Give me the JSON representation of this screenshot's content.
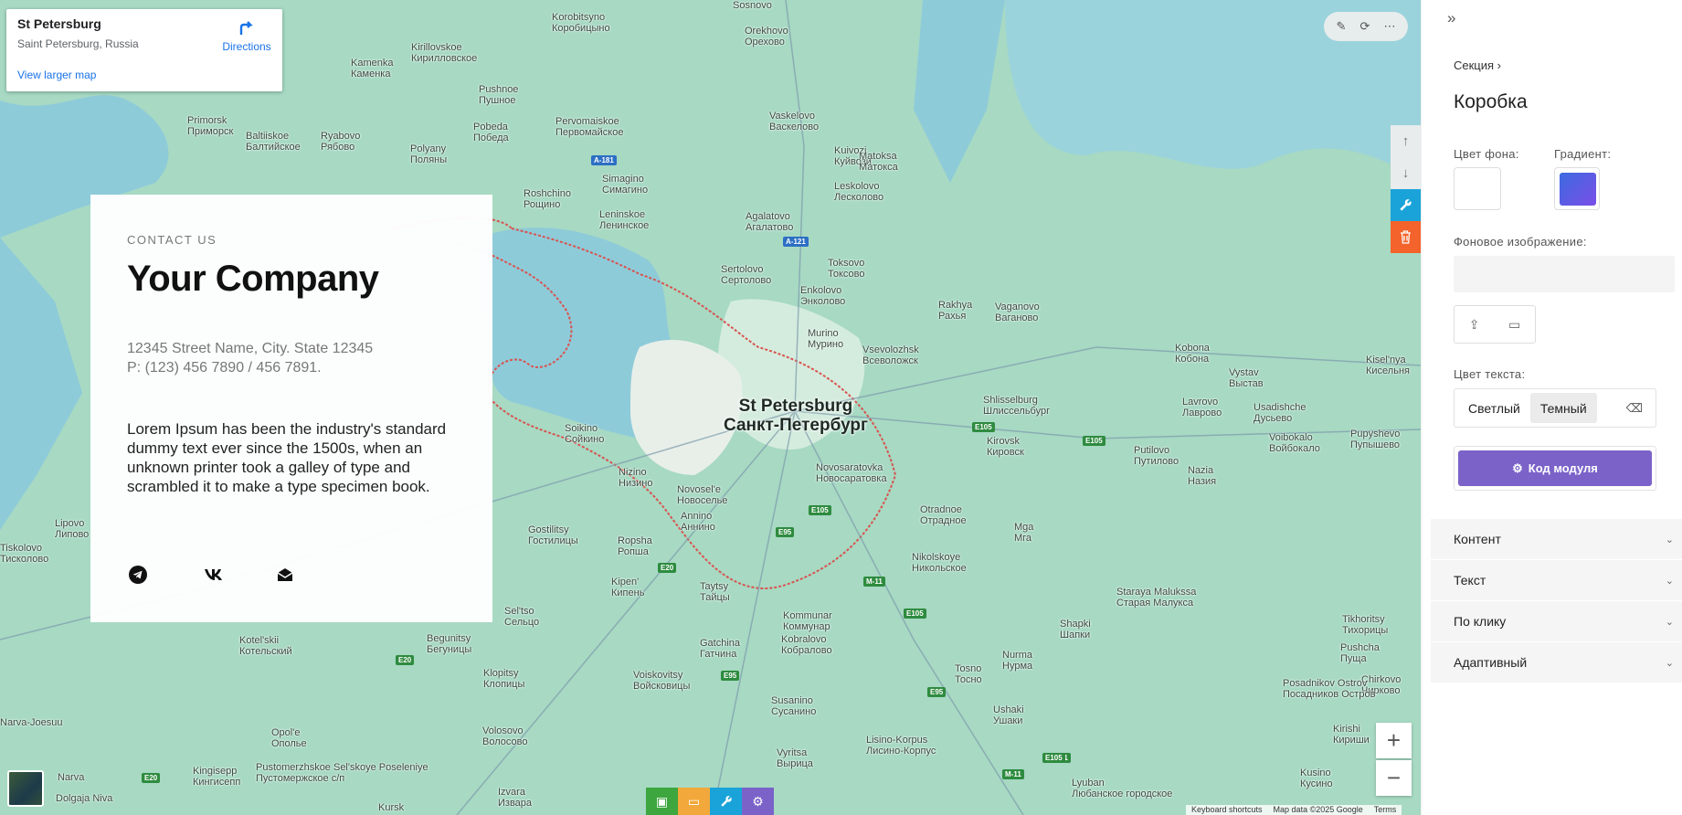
{
  "map": {
    "infocard": {
      "name": "St Petersburg",
      "address": "Saint Petersburg, Russia",
      "directions": "Directions",
      "larger_map": "View larger map"
    },
    "city_main": [
      "St Petersburg",
      "Санкт-Петербург"
    ],
    "places": [
      [
        "Korobitsyno",
        "Коробицыно"
      ],
      [
        "Orekhovo",
        "Орехово"
      ],
      [
        "Sosnovo",
        "Сосново"
      ],
      [
        "Kirillovskoe",
        "Кирилловское"
      ],
      [
        "Kamenka",
        "Каменка"
      ],
      [
        "Pushnoe",
        "Пушное"
      ],
      [
        "Pervomaiskoe",
        "Первомайское"
      ],
      [
        "Vaskelovo",
        "Васкелово"
      ],
      [
        "Primorsk",
        "Приморск"
      ],
      [
        "Baltiiskoe",
        "Балтийское"
      ],
      [
        "Ryabovo",
        "Рябово"
      ],
      [
        "Pobeda",
        "Победа"
      ],
      [
        "Polyany",
        "Поляны"
      ],
      [
        "Kuivozi",
        "Куйвози"
      ],
      [
        "Matoksa",
        "Матокса"
      ],
      [
        "Simagino",
        "Симагино"
      ],
      [
        "Leskolovo",
        "Лесколово"
      ],
      [
        "Roshchino",
        "Рощино"
      ],
      [
        "Leninskoe",
        "Ленинское"
      ],
      [
        "Agalatovo",
        "Агалатово"
      ],
      [
        "Sertolovo",
        "Сертолово"
      ],
      [
        "Toksovo",
        "Токсово"
      ],
      [
        "Enkolovo",
        "Энколово"
      ],
      [
        "Rakhya",
        "Рахья"
      ],
      [
        "Vaganovo",
        "Ваганово"
      ],
      [
        "Murino",
        "Мурино"
      ],
      [
        "Vsevolozhsk",
        "Всеволожск"
      ],
      [
        "Kobona",
        "Кобона"
      ],
      [
        "Kisel'nya",
        "Кисельня"
      ],
      [
        "Vystav",
        "Выстав"
      ],
      [
        "Shlisselburg",
        "Шлиссельбург"
      ],
      [
        "Lavrovo",
        "Лаврово"
      ],
      [
        "Usadishche",
        "Дусьево"
      ],
      [
        "Kirovsk",
        "Кировск"
      ],
      [
        "Putilovo",
        "Путилово"
      ],
      [
        "Voibokalo",
        "Войбокало"
      ],
      [
        "Pupyshevo",
        "Пупышево"
      ],
      [
        "Soikino",
        "Сойкино"
      ],
      [
        "Nazia",
        "Назия"
      ],
      [
        "Novosaratovka",
        "Новосаратовка"
      ],
      [
        "Nizino",
        "Низино"
      ],
      [
        "Novosel'e",
        "Новоселье"
      ],
      [
        "Annino",
        "Аннино"
      ],
      [
        "Otradnoe",
        "Отрадное"
      ],
      [
        "Mga",
        "Мга"
      ],
      [
        "Gostilitsy",
        "Гостилицы"
      ],
      [
        "Ropsha",
        "Ропша"
      ],
      [
        "Kipen'",
        "Кипень"
      ],
      [
        "Taytsy",
        "Тайцы"
      ],
      [
        "Nikolskoye",
        "Никольское"
      ],
      [
        "Kommunar",
        "Коммунар"
      ],
      [
        "Staraya Malukssa",
        "Старая Малукса"
      ],
      [
        "Sel'tso",
        "Сельцо"
      ],
      [
        "Shapki",
        "Шапки"
      ],
      [
        "Tikhoritsy",
        "Тихорицы"
      ],
      [
        "Kobralovo",
        "Кобралово"
      ],
      [
        "Begunitsy",
        "Бегуницы"
      ],
      [
        "Kotel'skii",
        "Котельский"
      ],
      [
        "Gatchina",
        "Гатчина"
      ],
      [
        "Tosno",
        "Тосно"
      ],
      [
        "Nurma",
        "Нурма"
      ],
      [
        "Pushcha",
        "Пуща"
      ],
      [
        "Chirkovo",
        "Чирково"
      ],
      [
        "Klopitsy",
        "Клопицы"
      ],
      [
        "Voiskovitsy",
        "Войсковицы"
      ],
      [
        "Susanino",
        "Сусанино"
      ],
      [
        "Posadnikov Ostrov",
        "Посадников Остров"
      ],
      [
        "Ushaki",
        "Ушаки"
      ],
      [
        "Opol'e",
        "Ополье"
      ],
      [
        "Volosovo",
        "Волосово"
      ],
      [
        "Lisino-Korpus",
        "Лисино-Корпус"
      ],
      [
        "Kirishi",
        "Кириши"
      ],
      [
        "Lipovo",
        "Липово"
      ],
      [
        "Tiskolovo",
        "Тисколово"
      ],
      [
        "Narva-Joesuu",
        ""
      ],
      [
        "Narva",
        "Нарва"
      ],
      [
        "Kingisepp",
        "Кингисепп"
      ],
      [
        "Pustomerzhskoe Sel'skoye Poseleniye",
        "Пустомержское с/п"
      ],
      [
        "Vyritsa",
        "Вырица"
      ],
      [
        "Izvara",
        "Извара"
      ],
      [
        "Kursk",
        ""
      ],
      [
        "Lyuban",
        "Любанское городское"
      ],
      [
        "Kusino",
        "Кусино"
      ],
      [
        "Dolgaja Niva",
        ""
      ]
    ],
    "roads": [
      "A-181",
      "A-121",
      "E105",
      "E105",
      "E105",
      "E95",
      "E20",
      "E95",
      "M-11",
      "E105",
      "E20",
      "E95",
      "M-11",
      "E20",
      "M-11",
      "E105"
    ],
    "attribution": [
      "Keyboard shortcuts",
      "Map data ©2025 Google",
      "Terms"
    ]
  },
  "contact_card": {
    "eyebrow": "CONTACT US",
    "company": "Your Company",
    "address_line1": "12345 Street Name, City. State 12345",
    "address_line2": "P: (123) 456 7890 / 456 7891.",
    "description": "Lorem Ipsum has been the industry's standard dummy text ever since the 1500s, when an unknown printer took a galley of type and scrambled it to make a type specimen book.",
    "social_icons": [
      "telegram-icon",
      "vk-icon",
      "mail-icon"
    ]
  },
  "editor_panel": {
    "breadcrumb": "Секция",
    "title": "Коробка",
    "bg_color_label": "Цвет фона:",
    "gradient_label": "Градиент:",
    "bg_image_label": "Фоновое изображение:",
    "text_color_label": "Цвет текста:",
    "text_color_options": [
      "Светлый",
      "Темный"
    ],
    "selected_text_color": "Темный",
    "code_button": "Код модуля",
    "accordions": [
      "Контент",
      "Текст",
      "По клику",
      "Адаптивный"
    ],
    "colors": {
      "bg": "#ffffff",
      "gradient_start": "#3d6ae0",
      "gradient_end": "#7a4ee8",
      "code_button": "#7a62c9"
    }
  },
  "toolbars": {
    "map_top": [
      "edit-icon",
      "refresh-icon",
      "more-icon"
    ],
    "side": [
      "arrow-up-icon",
      "arrow-down-icon",
      "wrench-icon",
      "trash-icon"
    ],
    "bottom": [
      "image-icon",
      "folder-icon",
      "wrench-icon",
      "gear-icon"
    ],
    "zoom": [
      "+",
      "−"
    ]
  }
}
